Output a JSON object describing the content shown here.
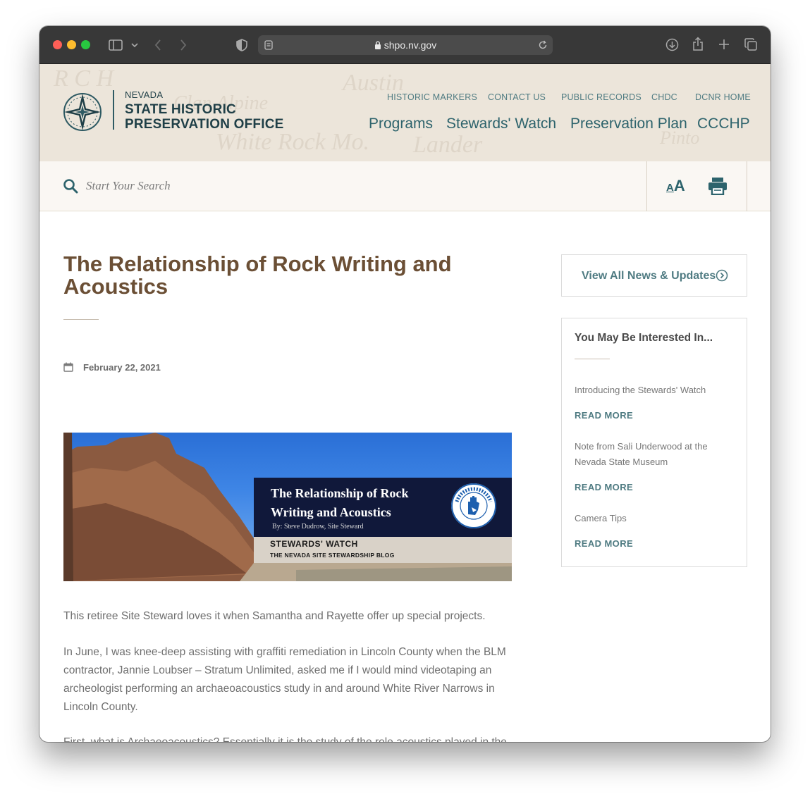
{
  "browser": {
    "url": "shpo.nv.gov"
  },
  "header": {
    "logo": {
      "line1": "NEVADA",
      "line2": "STATE HISTORIC",
      "line3": "PRESERVATION OFFICE"
    },
    "utility_links": [
      "HISTORIC MARKERS",
      "CONTACT US",
      "PUBLIC RECORDS",
      "CHDC",
      "DCNR HOME"
    ],
    "main_links": [
      "Programs",
      "Stewards' Watch",
      "Preservation Plan",
      "CCCHP"
    ]
  },
  "search": {
    "placeholder": "Start Your Search"
  },
  "article": {
    "title": "The Relationship of Rock Writing and Acoustics",
    "date": "February 22, 2021",
    "banner": {
      "title_line1": "The Relationship of Rock",
      "title_line2": "Writing and Acoustics",
      "byline": "By: Steve Dudrow, Site Steward",
      "series": "STEWARDS' WATCH",
      "blog": "THE NEVADA SITE STEWARDSHIP BLOG",
      "badge_text": "Nevada Site Stewardship Program"
    },
    "paragraphs": [
      "This retiree Site Steward loves it when Samantha and Rayette offer up special projects.",
      "In June, I was knee-deep assisting with graffiti remediation in Lincoln County when the BLM contractor, Jannie Loubser – Stratum Unlimited, asked me if I would mind videotaping an archeologist performing an archaeoacoustics study in and around White River Narrows in Lincoln County.",
      "First, what is Archaeoacoustics? Essentially it is the study of the role acoustics played in the"
    ]
  },
  "sidebar": {
    "news_button": "View All News & Updates",
    "interest_title": "You May Be Interested In...",
    "items": [
      {
        "title": "Introducing the Stewards' Watch",
        "link": "READ MORE"
      },
      {
        "title": "Note from Sali Underwood at the Nevada State Museum",
        "link": "READ MORE"
      },
      {
        "title": "Camera Tips",
        "link": "READ MORE"
      }
    ]
  },
  "colors": {
    "title_brown": "#6b4f35",
    "teal": "#2d636c",
    "header_bg": "#ece5da"
  }
}
